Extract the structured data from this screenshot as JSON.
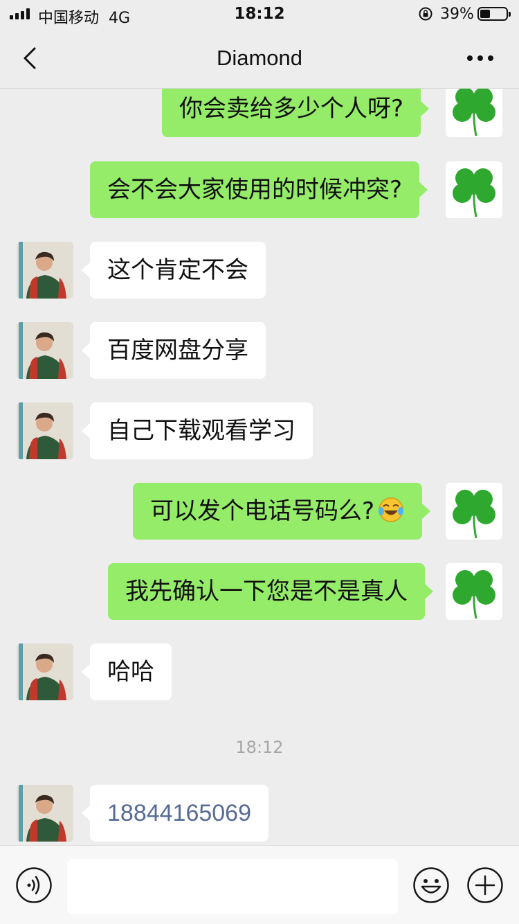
{
  "status_bar": {
    "carrier": "中国移动",
    "network": "4G",
    "time": "18:12",
    "battery": "39%",
    "battery_level": 0.39
  },
  "nav": {
    "title": "Diamond",
    "back_icon": "chevron-left-icon",
    "more_icon": "more-dots-icon"
  },
  "chat": {
    "messages": [
      {
        "side": "out",
        "text": "你会卖给多少个人呀?"
      },
      {
        "side": "out",
        "text": "会不会大家使用的时候冲突?"
      },
      {
        "side": "in",
        "text": "这个肯定不会"
      },
      {
        "side": "in",
        "text": "百度网盘分享"
      },
      {
        "side": "in",
        "text": "自己下载观看学习"
      },
      {
        "side": "out",
        "text": "可以发个电话号码么?",
        "emoji": "laughing-crying-emoji"
      },
      {
        "side": "out",
        "text": "我先确认一下您是不是真人"
      },
      {
        "side": "in",
        "text": "哈哈"
      },
      {
        "side": "in",
        "text": "18844165069"
      }
    ],
    "timestamp": "18:12"
  },
  "input_bar": {
    "voice_icon": "voice-icon",
    "emoji_icon": "emoji-icon",
    "plus_icon": "plus-icon",
    "input_value": ""
  },
  "colors": {
    "outgoing_bubble": "#95ec69",
    "incoming_bubble": "#ffffff",
    "background": "#ededed",
    "link": "#576b95"
  }
}
